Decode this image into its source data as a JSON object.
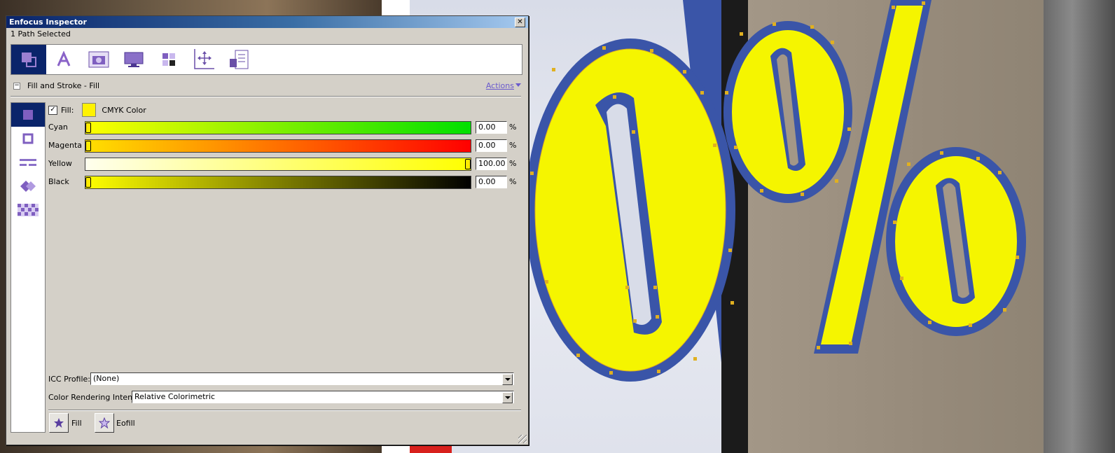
{
  "window": {
    "title": "Enfocus Inspector",
    "close_glyph": "✕"
  },
  "selection_status": "1 Path Selected",
  "toolbar": {
    "tools": [
      {
        "name": "fill-stroke-icon",
        "active": true
      },
      {
        "name": "text-icon"
      },
      {
        "name": "image-icon"
      },
      {
        "name": "monitor-icon"
      },
      {
        "name": "color-grid-icon"
      },
      {
        "name": "position-icon"
      },
      {
        "name": "document-info-icon"
      }
    ]
  },
  "section": {
    "title": "Fill and Stroke - Fill",
    "toggle": "−",
    "actions_label": "Actions"
  },
  "side_panel": {
    "items": [
      "fill-icon",
      "stroke-icon",
      "dash-icon",
      "join-icon",
      "pattern-icon"
    ]
  },
  "fill": {
    "checked": true,
    "check_glyph": "✓",
    "label": "Fill:",
    "swatch_color": "#fff200",
    "color_mode": "CMYK Color"
  },
  "sliders": [
    {
      "label": "Cyan",
      "value": "0.00",
      "unit": "%",
      "fraction": 0.0
    },
    {
      "label": "Magenta",
      "value": "0.00",
      "unit": "%",
      "fraction": 0.0
    },
    {
      "label": "Yellow",
      "value": "100.00",
      "unit": "%",
      "fraction": 1.0
    },
    {
      "label": "Black",
      "value": "0.00",
      "unit": "%",
      "fraction": 0.0
    }
  ],
  "icc_profile": {
    "label": "ICC Profile:",
    "value": "(None)"
  },
  "rendering_intent": {
    "label": "Color Rendering Intent:",
    "value": "Relative Colorimetric"
  },
  "fill_modes": {
    "fill_label": "Fill",
    "eofill_label": "Eofill"
  },
  "colors": {
    "accent": "#0a246a",
    "yellow": "#f5f500",
    "blue": "#3a55a8",
    "anchor": "#e0b020"
  }
}
